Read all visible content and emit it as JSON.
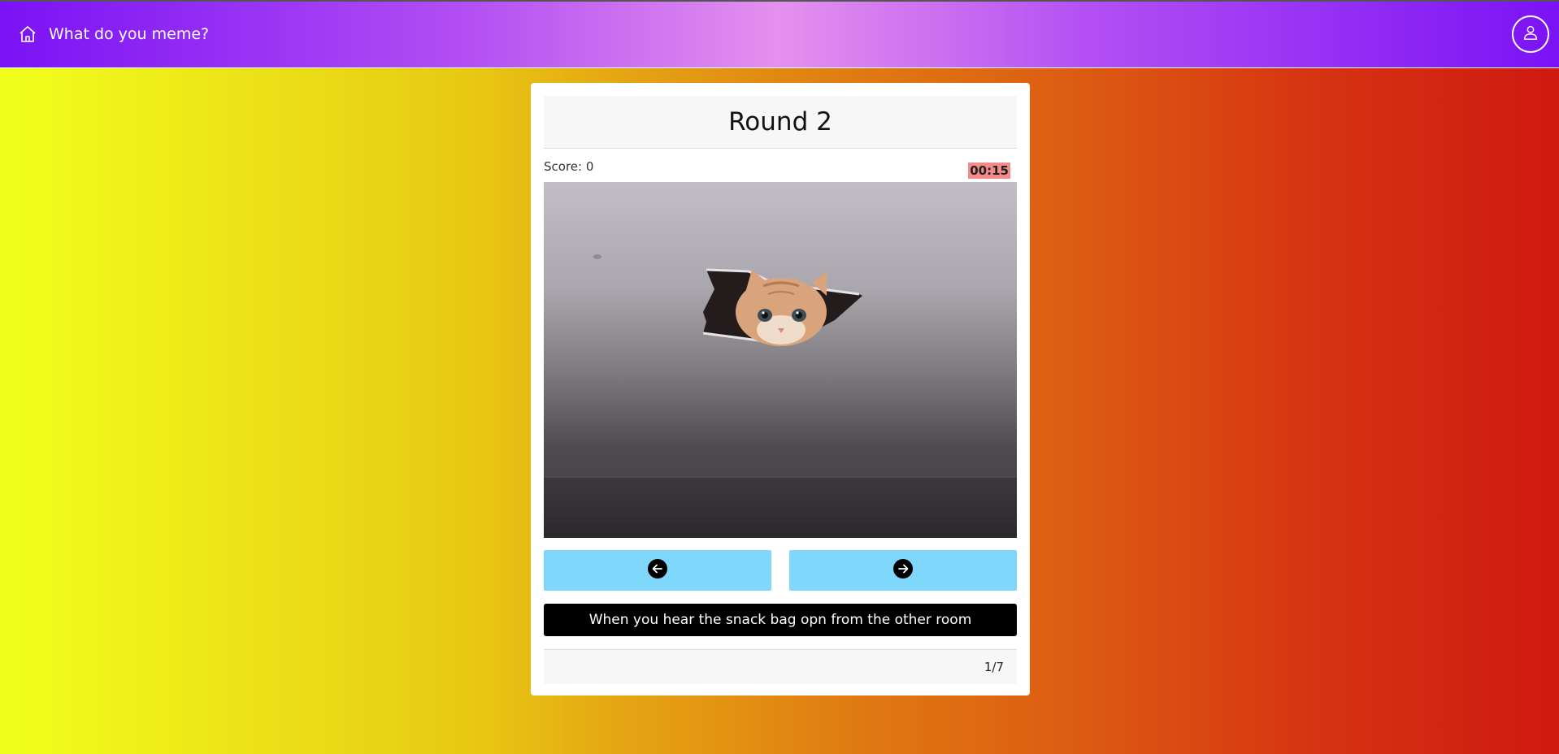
{
  "navbar": {
    "title": "What do you meme?",
    "home_icon": "home-icon",
    "profile_icon": "user-icon"
  },
  "card": {
    "title": "Round 2",
    "score_label": "Score: 0",
    "timer": "00:15",
    "image_icon": "meme-image",
    "prev_icon": "arrow-left-circle-icon",
    "next_icon": "arrow-right-circle-icon",
    "caption": "When you hear the snack bag opn from the other room",
    "counter": "1/7"
  },
  "colors": {
    "nav_gradient": [
      "#7a12f5",
      "#e590ee",
      "#7a12f5"
    ],
    "page_gradient": [
      "#f1ff1c",
      "#e07a12",
      "#cf1910"
    ],
    "button": "#7fd8fb",
    "timer_bg": "#f48a8a",
    "caption_bg": "#000000"
  }
}
